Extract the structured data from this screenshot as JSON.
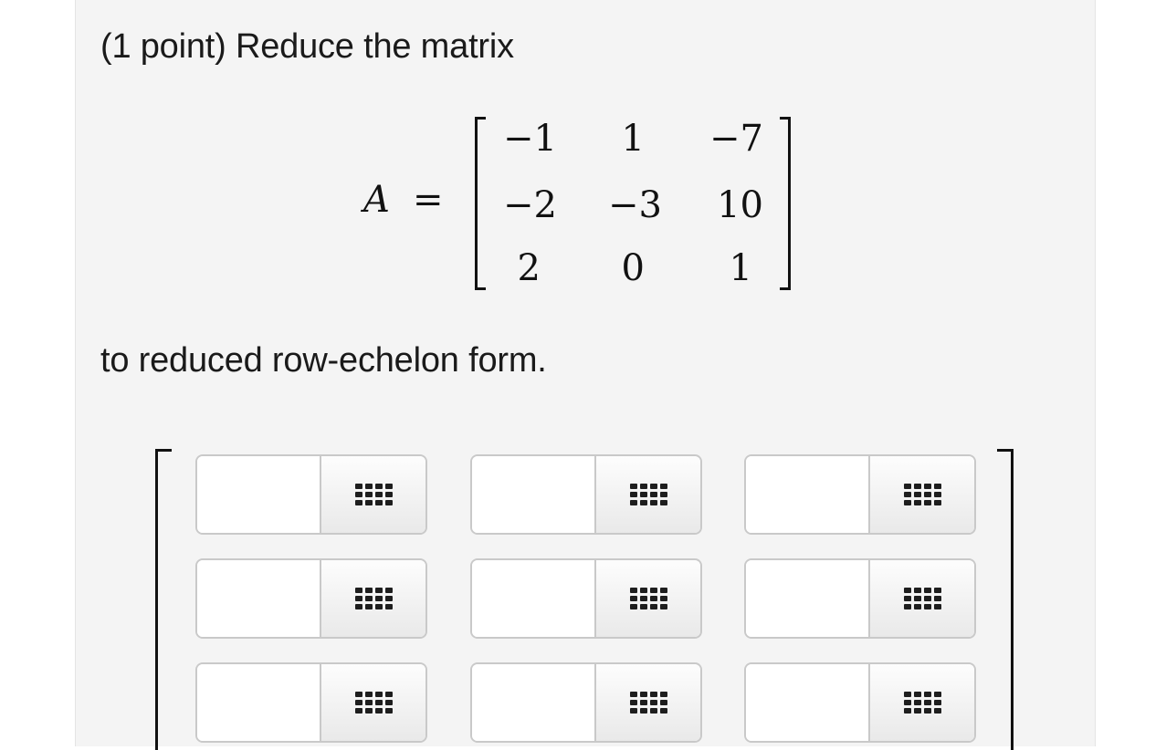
{
  "problem": {
    "prompt": "(1 point) Reduce the matrix",
    "instruction": "to reduced row-echelon form.",
    "matrix_variable": "A",
    "equals": "=",
    "matrix": [
      [
        "−1",
        "1",
        "−7"
      ],
      [
        "−2",
        "−3",
        "10"
      ],
      [
        "2",
        "0",
        "1"
      ]
    ]
  },
  "answer": {
    "rows": 3,
    "cols": 3,
    "cells": [
      [
        "",
        "",
        ""
      ],
      [
        "",
        "",
        ""
      ],
      [
        "",
        "",
        ""
      ]
    ],
    "palette_icon": "grid-keypad-icon"
  }
}
